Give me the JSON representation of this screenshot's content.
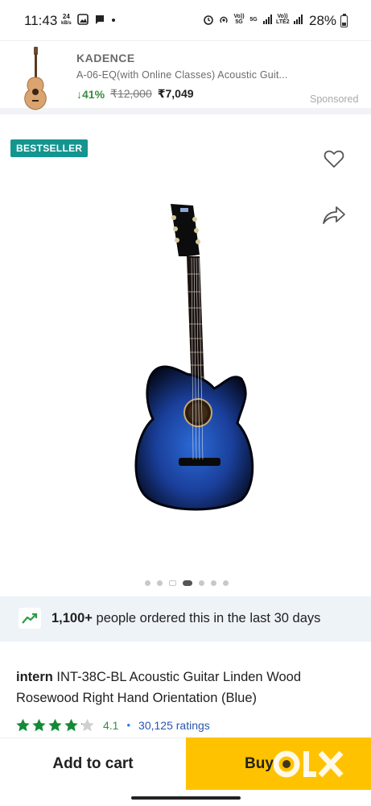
{
  "status_bar": {
    "time": "11:43",
    "kbs_value": "24",
    "kbs_unit": "kB/s",
    "net1": "Vo)) 5G",
    "net2": "5G",
    "net3": "Vo)) LTE2",
    "battery": "28%"
  },
  "ad": {
    "brand": "KADENCE",
    "title": "A-06-EQ(with Online Classes) Acoustic Guit...",
    "discount": "↓41%",
    "mrp": "₹12,000",
    "price": "₹7,049",
    "sponsored": "Sponsored"
  },
  "gallery": {
    "badge": "BESTSELLER",
    "image_count": 7,
    "active_index": 3
  },
  "social_proof": {
    "count": "1,100+",
    "text": " people ordered this in the last 30 days"
  },
  "product": {
    "brand": "intern",
    "title": " INT-38C-BL Acoustic Guitar Linden Wood Rosewood Right Hand Orientation (Blue)",
    "rating": "4.1",
    "rating_stars": 4.1,
    "separator": "•",
    "ratings_count": "30,125 ratings"
  },
  "actions": {
    "add_to_cart": "Add to cart",
    "buy_now": "Buy"
  },
  "watermark": "OLX",
  "colors": {
    "bestseller_badge": "#14958f",
    "discount_green": "#388e3c",
    "star_green": "#138a36",
    "buy_yellow": "#ffc200",
    "proof_bg": "#eef3f8"
  }
}
